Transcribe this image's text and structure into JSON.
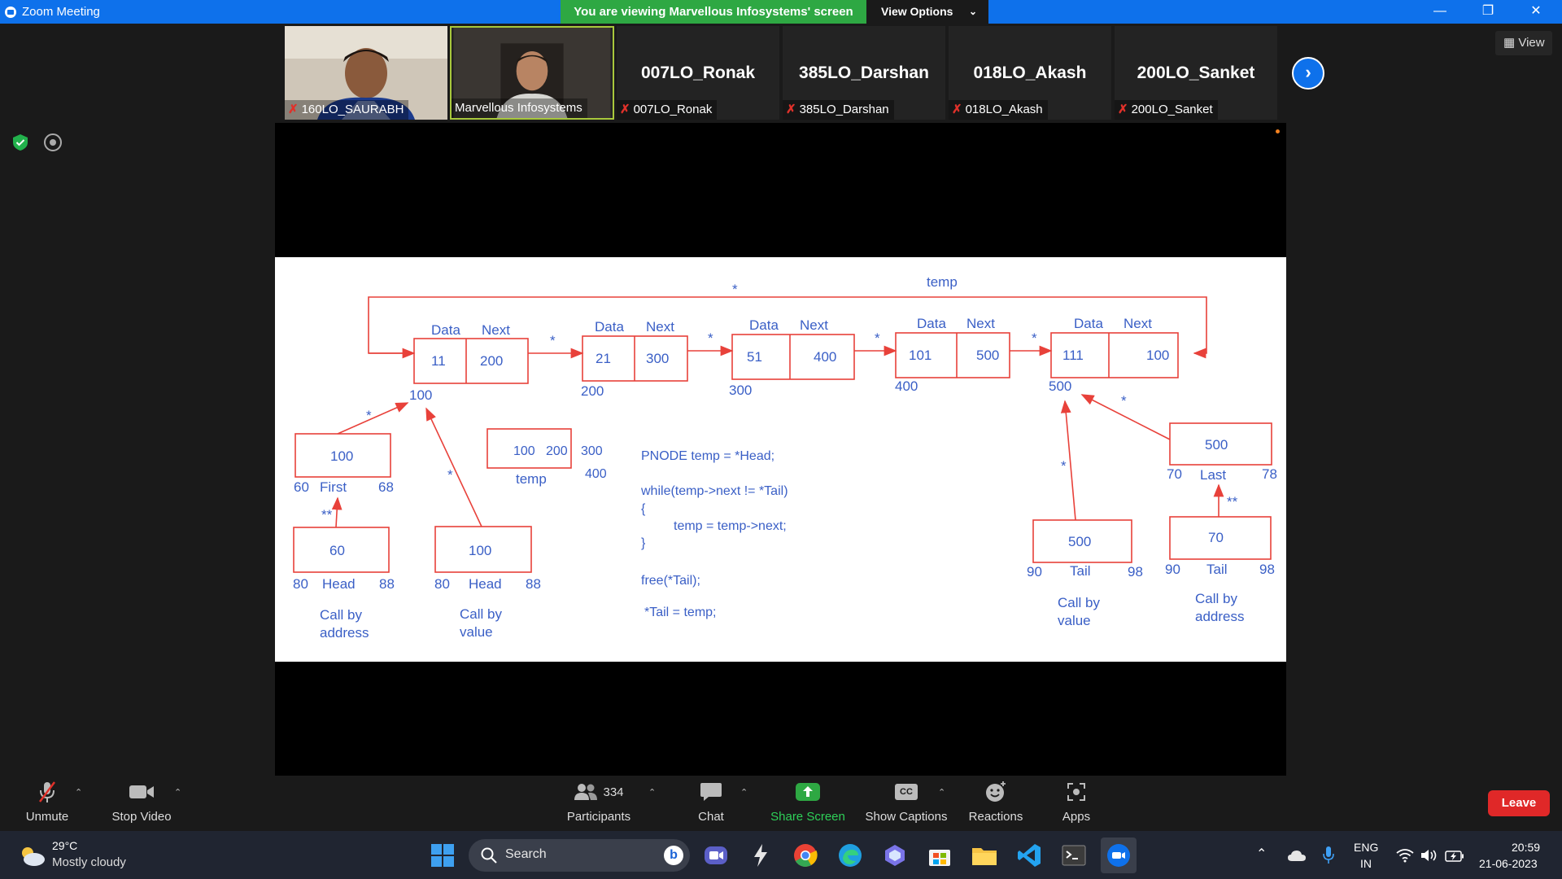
{
  "window": {
    "title": "Zoom Meeting",
    "banner": "You are viewing Marvellous Infosystems' screen",
    "view_options": "View Options"
  },
  "thumbnails": [
    {
      "name": "160LO_SAURABH",
      "muted": true,
      "video": true
    },
    {
      "name": "Marvellous Infosystems",
      "muted": false,
      "video": true
    },
    {
      "name": "007LO_Ronak",
      "big": "007LO_Ronak",
      "muted": true
    },
    {
      "name": "385LO_Darshan",
      "big": "385LO_Darshan",
      "muted": true
    },
    {
      "name": "018LO_Akash",
      "big": "018LO_Akash",
      "muted": true
    },
    {
      "name": "200LO_Sanket",
      "big": "200LO_Sanket",
      "muted": true
    }
  ],
  "view_button": "View",
  "slide": {
    "temp_top": "temp",
    "nodes": [
      {
        "data": "11",
        "next": "200",
        "addr": "100",
        "h_data": "Data",
        "h_next": "Next"
      },
      {
        "data": "21",
        "next": "300",
        "addr": "200",
        "h_data": "Data",
        "h_next": "Next"
      },
      {
        "data": "51",
        "next": "400",
        "addr": "300",
        "h_data": "Data",
        "h_next": "Next"
      },
      {
        "data": "101",
        "next": "500",
        "addr": "400",
        "h_data": "Data",
        "h_next": "Next"
      },
      {
        "data": "111",
        "next": "100",
        "addr": "500",
        "h_data": "Data",
        "h_next": "Next"
      }
    ],
    "first": {
      "value": "100",
      "name": "First",
      "start": "60",
      "end": "68"
    },
    "head_addr": {
      "value": "60",
      "name": "Head",
      "start": "80",
      "end": "88",
      "caption": [
        "Call by",
        "address"
      ]
    },
    "head_val": {
      "value": "100",
      "name": "Head",
      "start": "80",
      "end": "88",
      "caption": [
        "Call by",
        "value"
      ]
    },
    "temp_box": {
      "v1": "100",
      "v2": "200",
      "name": "temp",
      "s1": "300",
      "s2": "400"
    },
    "code": [
      "PNODE temp = *Head;",
      "while(temp->next != *Tail)",
      "{",
      "temp = temp->next;",
      "}",
      "free(*Tail);",
      "*Tail = temp;"
    ],
    "tail_val": {
      "value": "500",
      "name": "Tail",
      "start": "90",
      "end": "98",
      "caption": [
        "Call by",
        "value"
      ]
    },
    "last": {
      "value": "500",
      "name": "Last",
      "start": "70",
      "end": "78"
    },
    "tail_addr": {
      "value": "70",
      "name": "Tail",
      "start": "90",
      "end": "98",
      "caption": [
        "Call by",
        "address"
      ]
    },
    "star": "*",
    "dstar": "**"
  },
  "toolbar": {
    "unmute": "Unmute",
    "stop_video": "Stop Video",
    "participants": "Participants",
    "participants_count": "334",
    "chat": "Chat",
    "share_screen": "Share Screen",
    "show_captions": "Show Captions",
    "cc": "CC",
    "reactions": "Reactions",
    "apps": "Apps",
    "leave": "Leave"
  },
  "taskbar": {
    "temp": "29°C",
    "weather": "Mostly cloudy",
    "search": "Search",
    "lang1": "ENG",
    "lang2": "IN",
    "time": "20:59",
    "date": "21-06-2023"
  },
  "colors": {
    "zoom_blue": "#0e71eb",
    "banner_green": "#2ea843",
    "diagram_red": "#e8413a",
    "diagram_blue": "#3a5fc6",
    "leave_red": "#e02828"
  }
}
